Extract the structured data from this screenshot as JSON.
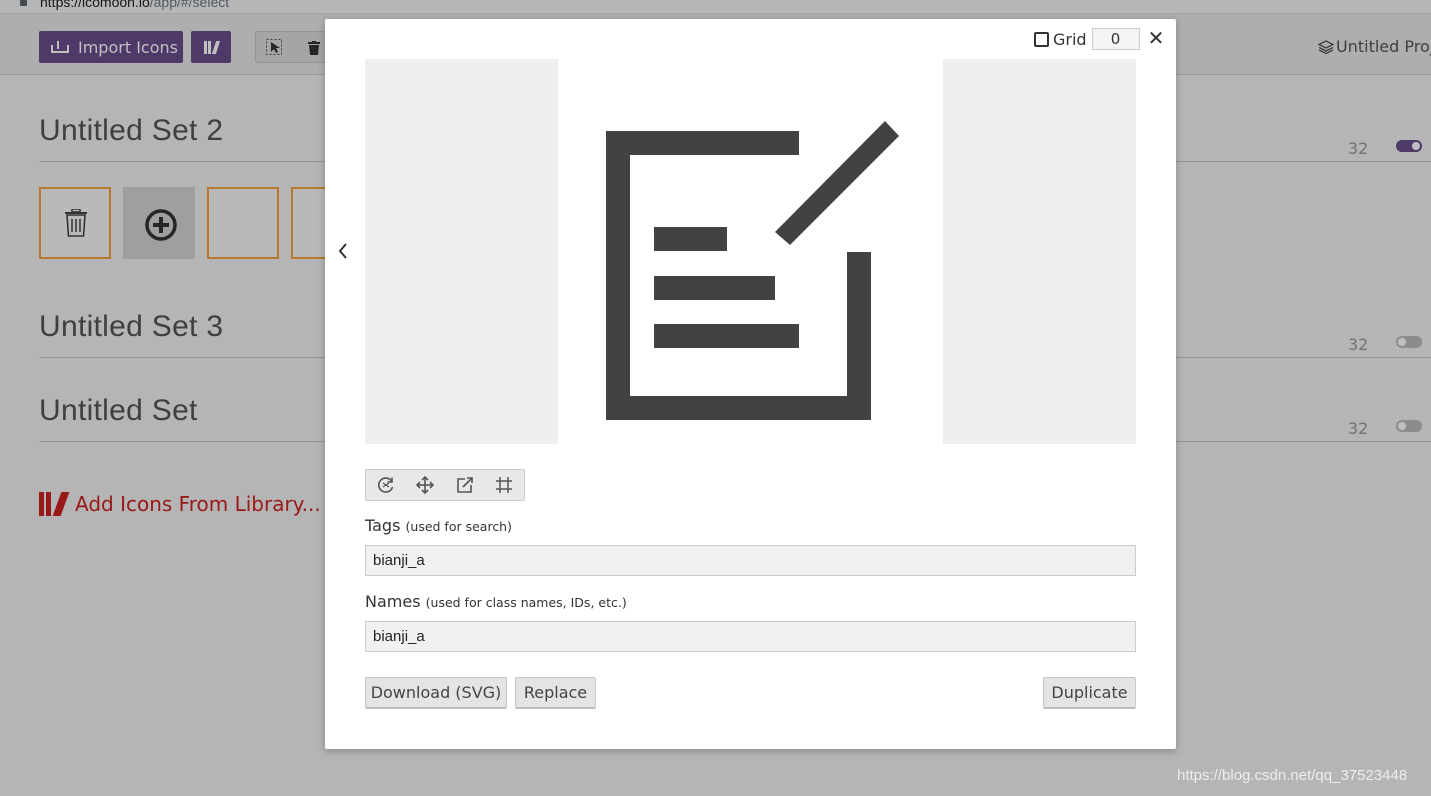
{
  "browser": {
    "url_host": "https://icomoon.io",
    "url_path": "/app/#/select"
  },
  "toolbar": {
    "import_label": "Import Icons",
    "project_name": "Untitled Proj"
  },
  "sets": [
    {
      "title": "Untitled Set 2",
      "count": "32",
      "enabled": true
    },
    {
      "title": "Untitled Set 3",
      "count": "32",
      "enabled": false
    },
    {
      "title": "Untitled Set",
      "count": "32",
      "enabled": false
    }
  ],
  "add_library_label": "Add Icons From Library...",
  "modal": {
    "grid_label": "Grid",
    "grid_value": "0",
    "tags_label": "Tags",
    "tags_hint": "(used for search)",
    "tags_value": "bianji_a",
    "names_label": "Names",
    "names_hint": "(used for class names, IDs, etc.)",
    "names_value": "bianji_a",
    "download_label": "Download (SVG)",
    "replace_label": "Replace",
    "duplicate_label": "Duplicate",
    "icon_name": "edit-document-icon"
  },
  "colors": {
    "accent": "#6a4c8c",
    "selection_border": "#f2a33a",
    "library_link": "#cc2222",
    "icon_fill": "#424242"
  },
  "watermark": "https://blog.csdn.net/qq_37523448"
}
